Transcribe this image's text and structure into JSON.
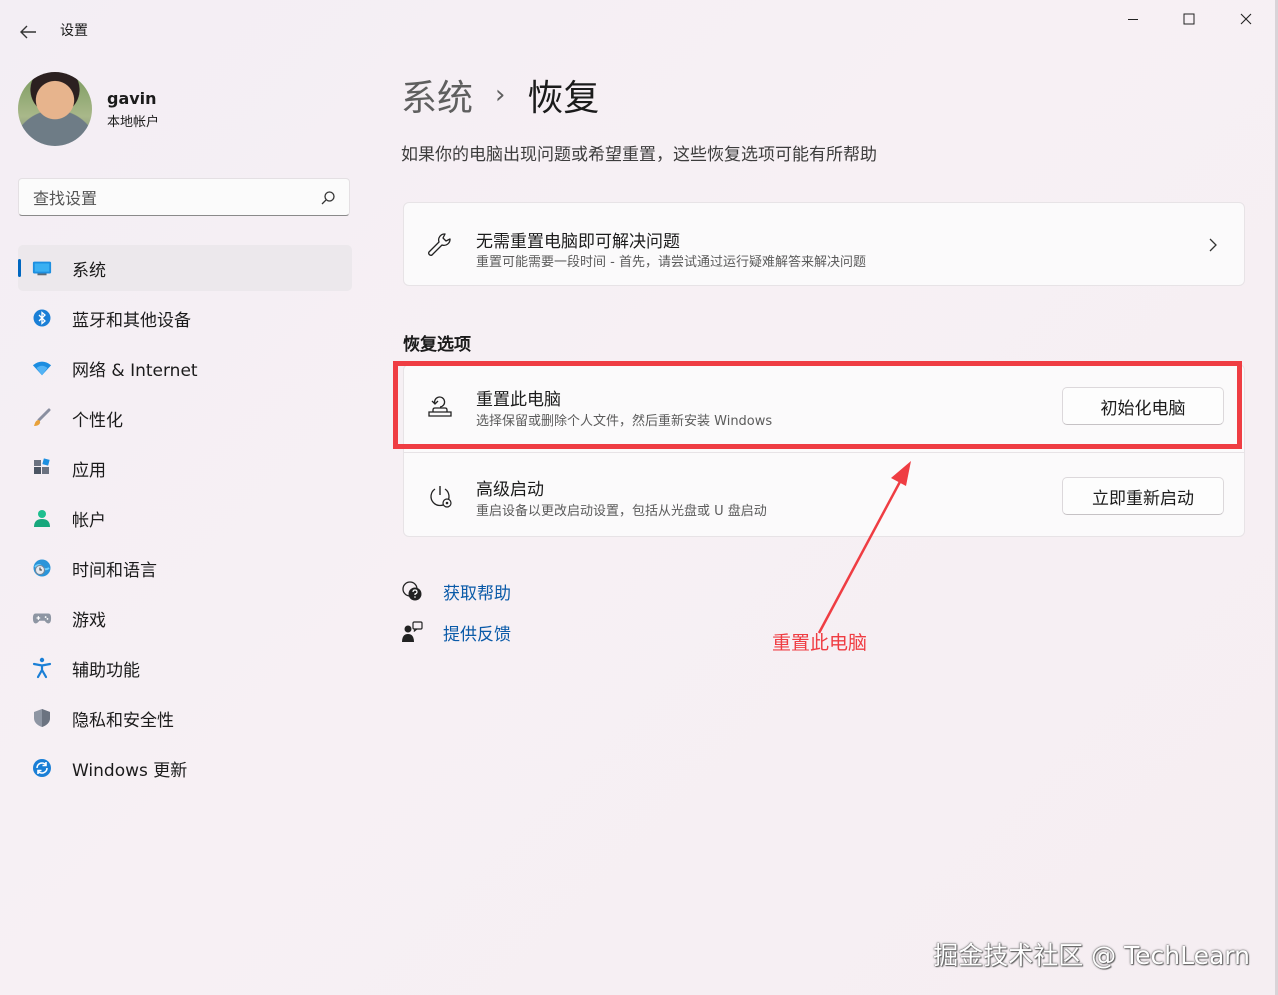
{
  "window": {
    "title": "设置",
    "controls": [
      "minimize",
      "maximize",
      "close"
    ]
  },
  "user": {
    "name": "gavin",
    "account_type": "本地帐户"
  },
  "search": {
    "placeholder": "查找设置"
  },
  "sidebar": {
    "items": [
      {
        "label": "系统",
        "icon": "monitor-icon",
        "active": true
      },
      {
        "label": "蓝牙和其他设备",
        "icon": "bluetooth-icon"
      },
      {
        "label": "网络 & Internet",
        "icon": "wifi-icon"
      },
      {
        "label": "个性化",
        "icon": "brush-icon"
      },
      {
        "label": "应用",
        "icon": "apps-icon"
      },
      {
        "label": "帐户",
        "icon": "person-icon"
      },
      {
        "label": "时间和语言",
        "icon": "globe-clock-icon"
      },
      {
        "label": "游戏",
        "icon": "gamepad-icon"
      },
      {
        "label": "辅助功能",
        "icon": "accessibility-icon"
      },
      {
        "label": "隐私和安全性",
        "icon": "shield-icon"
      },
      {
        "label": "Windows 更新",
        "icon": "update-icon"
      }
    ]
  },
  "main": {
    "breadcrumb": {
      "parent": "系统",
      "separator": "›",
      "current": "恢复"
    },
    "subtitle": "如果你的电脑出现问题或希望重置，这些恢复选项可能有所帮助",
    "troubleshoot": {
      "title": "无需重置电脑即可解决问题",
      "description": "重置可能需要一段时间 - 首先，请尝试通过运行疑难解答来解决问题"
    },
    "section_title": "恢复选项",
    "reset_pc": {
      "title": "重置此电脑",
      "description": "选择保留或删除个人文件，然后重新安装 Windows",
      "button": "初始化电脑"
    },
    "advanced_startup": {
      "title": "高级启动",
      "description": "重启设备以更改启动设置，包括从光盘或 U 盘启动",
      "button": "立即重新启动"
    },
    "links": {
      "help": "获取帮助",
      "feedback": "提供反馈"
    }
  },
  "annotation": {
    "label": "重置此电脑",
    "color": "#ef3d43"
  },
  "watermark": "掘金技术社区 @ TechLearn",
  "colors": {
    "accent": "#0067c0",
    "link": "#0a5aa8",
    "highlight": "#ef3d43"
  }
}
